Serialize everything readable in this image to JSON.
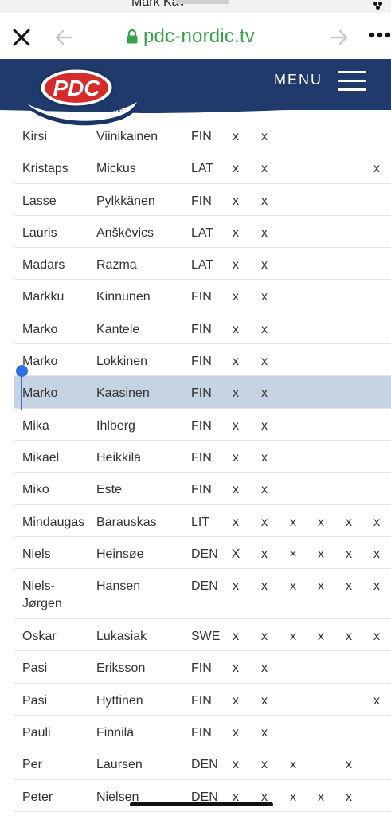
{
  "status": {
    "partial_title": "Mark Kav"
  },
  "browser": {
    "url": "pdc-nordic.tv",
    "close_icon": "close-icon",
    "back_icon": "back-arrow-icon",
    "forward_icon": "forward-arrow-icon",
    "more_icon": "more-dots-icon",
    "url_color": "#3aa14a"
  },
  "site": {
    "logo_text": "PDC",
    "logo_sub": "NORDIC & BALTIC",
    "menu_label": "MENU",
    "header_color": "#203a6b"
  },
  "table": {
    "highlight_color": "#c5d3e3",
    "rows": [
      {
        "first": "Kirsi",
        "last": "Viinikainen",
        "nat": "FIN",
        "marks": [
          "x",
          "x",
          "",
          "",
          "",
          ""
        ]
      },
      {
        "first": "Kristaps",
        "last": "Mickus",
        "nat": "LAT",
        "marks": [
          "x",
          "x",
          "",
          "",
          "",
          "x"
        ]
      },
      {
        "first": "Lasse",
        "last": "Pylkkänen",
        "nat": "FIN",
        "marks": [
          "x",
          "x",
          "",
          "",
          "",
          ""
        ]
      },
      {
        "first": "Lauris",
        "last": "Anškēvics",
        "nat": "LAT",
        "marks": [
          "x",
          "x",
          "",
          "",
          "",
          ""
        ]
      },
      {
        "first": "Madars",
        "last": "Razma",
        "nat": "LAT",
        "marks": [
          "x",
          "x",
          "",
          "",
          "",
          ""
        ]
      },
      {
        "first": "Markku",
        "last": "Kinnunen",
        "nat": "FIN",
        "marks": [
          "x",
          "x",
          "",
          "",
          "",
          ""
        ]
      },
      {
        "first": "Marko",
        "last": "Kantele",
        "nat": "FIN",
        "marks": [
          "x",
          "x",
          "",
          "",
          "",
          ""
        ]
      },
      {
        "first": "Marko",
        "last": "Lokkinen",
        "nat": "FIN",
        "marks": [
          "x",
          "x",
          "",
          "",
          "",
          ""
        ]
      },
      {
        "first": "Marko",
        "last": "Kaasinen",
        "nat": "FIN",
        "marks": [
          "x",
          "x",
          "",
          "",
          "",
          ""
        ],
        "highlight": true
      },
      {
        "first": "Mika",
        "last": "Ihlberg",
        "nat": "FIN",
        "marks": [
          "x",
          "x",
          "",
          "",
          "",
          ""
        ]
      },
      {
        "first": "Mikael",
        "last": "Heikkilä",
        "nat": "FIN",
        "marks": [
          "x",
          "x",
          "",
          "",
          "",
          ""
        ]
      },
      {
        "first": "Miko",
        "last": "Este",
        "nat": "FIN",
        "marks": [
          "x",
          "x",
          "",
          "",
          "",
          ""
        ]
      },
      {
        "first": "Mindaugas",
        "last": "Barauskas",
        "nat": "LIT",
        "marks": [
          "x",
          "x",
          "x",
          "x",
          "x",
          "x"
        ]
      },
      {
        "first": "Niels",
        "last": "Heinsøe",
        "nat": "DEN",
        "marks": [
          "X",
          "x",
          "×",
          "x",
          "x",
          "x"
        ]
      },
      {
        "first": "Niels-Jørgen",
        "last": "Hansen",
        "nat": "DEN",
        "marks": [
          "x",
          "x",
          "x",
          "x",
          "x",
          "x"
        ],
        "tall": true
      },
      {
        "first": "Oskar",
        "last": "Lukasiak",
        "nat": "SWE",
        "marks": [
          "x",
          "x",
          "x",
          "x",
          "x",
          "x"
        ]
      },
      {
        "first": "Pasi",
        "last": "Eriksson",
        "nat": "FIN",
        "marks": [
          "x",
          "x",
          "",
          "",
          "",
          ""
        ]
      },
      {
        "first": "Pasi",
        "last": "Hyttinen",
        "nat": "FIN",
        "marks": [
          "x",
          "x",
          "",
          "",
          "",
          "x"
        ]
      },
      {
        "first": "Pauli",
        "last": "Finnilä",
        "nat": "FIN",
        "marks": [
          "x",
          "x",
          "",
          "",
          "",
          ""
        ]
      },
      {
        "first": "Per",
        "last": "Laursen",
        "nat": "DEN",
        "marks": [
          "x",
          "x",
          "x",
          "",
          "x",
          ""
        ]
      },
      {
        "first": "Peter",
        "last": "Nielsen",
        "nat": "DEN",
        "marks": [
          "x",
          "x",
          "x",
          "x",
          "x",
          ""
        ]
      }
    ]
  }
}
